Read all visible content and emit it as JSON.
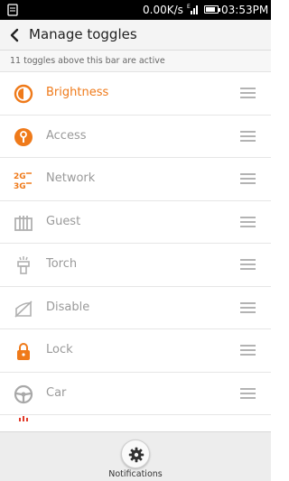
{
  "status_bar": {
    "speed": "0.00K/s",
    "time": "03:53PM",
    "icons": [
      "notification-icon",
      "signal-icon",
      "battery-icon"
    ]
  },
  "header": {
    "title": "Manage toggles",
    "back_icon": "chevron-left-icon"
  },
  "info_bar": {
    "text": "11 toggles above this bar are active"
  },
  "toggles": [
    {
      "label": "Brightness",
      "icon": "brightness-icon",
      "active": true
    },
    {
      "label": "Access",
      "icon": "access-icon",
      "active": false
    },
    {
      "label": "Network",
      "icon": "network-icon",
      "active": false
    },
    {
      "label": "Guest",
      "icon": "guest-icon",
      "active": false
    },
    {
      "label": "Torch",
      "icon": "torch-icon",
      "active": false
    },
    {
      "label": "Disable",
      "icon": "disable-icon",
      "active": false
    },
    {
      "label": "Lock",
      "icon": "lock-icon",
      "active": false
    },
    {
      "label": "Car",
      "icon": "car-icon",
      "active": false
    }
  ],
  "bottom_bar": {
    "label": "Notifications",
    "icon": "gear-icon"
  },
  "colors": {
    "accent": "#ef7a1a",
    "inactive_text": "#9a9a9a",
    "inactive_icon": "#b0b0b0"
  }
}
